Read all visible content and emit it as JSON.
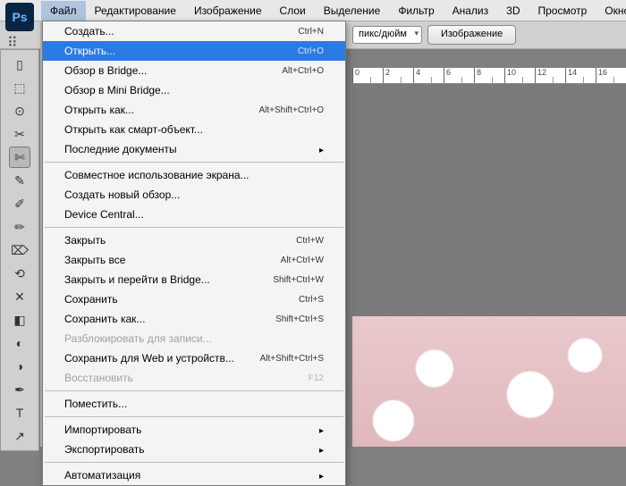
{
  "app": {
    "logo": "Ps"
  },
  "menubar": {
    "items": [
      "Файл",
      "Редактирование",
      "Изображение",
      "Слои",
      "Выделение",
      "Фильтр",
      "Анализ",
      "3D",
      "Просмотр",
      "Окно"
    ],
    "active_index": 0
  },
  "optbar": {
    "units_label": "пикс/дюйм",
    "image_button": "Изображение"
  },
  "ruler": {
    "ticks": [
      "0",
      "2",
      "4",
      "6",
      "8",
      "10",
      "12",
      "14",
      "16"
    ]
  },
  "dropdown": {
    "groups": [
      [
        {
          "label": "Создать...",
          "shortcut": "Ctrl+N"
        },
        {
          "label": "Открыть...",
          "shortcut": "Ctrl+O",
          "highlight": true
        },
        {
          "label": "Обзор в Bridge...",
          "shortcut": "Alt+Ctrl+O"
        },
        {
          "label": "Обзор в Mini Bridge..."
        },
        {
          "label": "Открыть как...",
          "shortcut": "Alt+Shift+Ctrl+O"
        },
        {
          "label": "Открыть как смарт-объект..."
        },
        {
          "label": "Последние документы",
          "submenu": true
        }
      ],
      [
        {
          "label": "Совместное использование экрана..."
        },
        {
          "label": "Создать новый обзор..."
        },
        {
          "label": "Device Central..."
        }
      ],
      [
        {
          "label": "Закрыть",
          "shortcut": "Ctrl+W"
        },
        {
          "label": "Закрыть все",
          "shortcut": "Alt+Ctrl+W"
        },
        {
          "label": "Закрыть и перейти в Bridge...",
          "shortcut": "Shift+Ctrl+W"
        },
        {
          "label": "Сохранить",
          "shortcut": "Ctrl+S"
        },
        {
          "label": "Сохранить как...",
          "shortcut": "Shift+Ctrl+S"
        },
        {
          "label": "Разблокировать для записи...",
          "disabled": true
        },
        {
          "label": "Сохранить для Web и устройств...",
          "shortcut": "Alt+Shift+Ctrl+S"
        },
        {
          "label": "Восстановить",
          "shortcut": "F12",
          "disabled": true
        }
      ],
      [
        {
          "label": "Поместить..."
        }
      ],
      [
        {
          "label": "Импортировать",
          "submenu": true
        },
        {
          "label": "Экспортировать",
          "submenu": true
        }
      ],
      [
        {
          "label": "Автоматизация",
          "submenu": true
        }
      ]
    ]
  },
  "tools": [
    {
      "glyph": "▯",
      "name": "move-tool"
    },
    {
      "glyph": "⬚",
      "name": "marquee-tool"
    },
    {
      "glyph": "⊙",
      "name": "lasso-tool"
    },
    {
      "glyph": "✂",
      "name": "quick-select-tool"
    },
    {
      "glyph": "✄",
      "name": "crop-tool",
      "selected": true
    },
    {
      "glyph": "✎",
      "name": "eyedropper-tool"
    },
    {
      "glyph": "✐",
      "name": "healing-tool"
    },
    {
      "glyph": "✏",
      "name": "brush-tool"
    },
    {
      "glyph": "⌦",
      "name": "stamp-tool"
    },
    {
      "glyph": "⟲",
      "name": "history-brush-tool"
    },
    {
      "glyph": "✕",
      "name": "eraser-tool"
    },
    {
      "glyph": "◧",
      "name": "gradient-tool"
    },
    {
      "glyph": "◐",
      "name": "blur-tool"
    },
    {
      "glyph": "◑",
      "name": "dodge-tool"
    },
    {
      "glyph": "✒",
      "name": "pen-tool"
    },
    {
      "glyph": "T",
      "name": "type-tool"
    },
    {
      "glyph": "↗",
      "name": "path-tool"
    }
  ]
}
